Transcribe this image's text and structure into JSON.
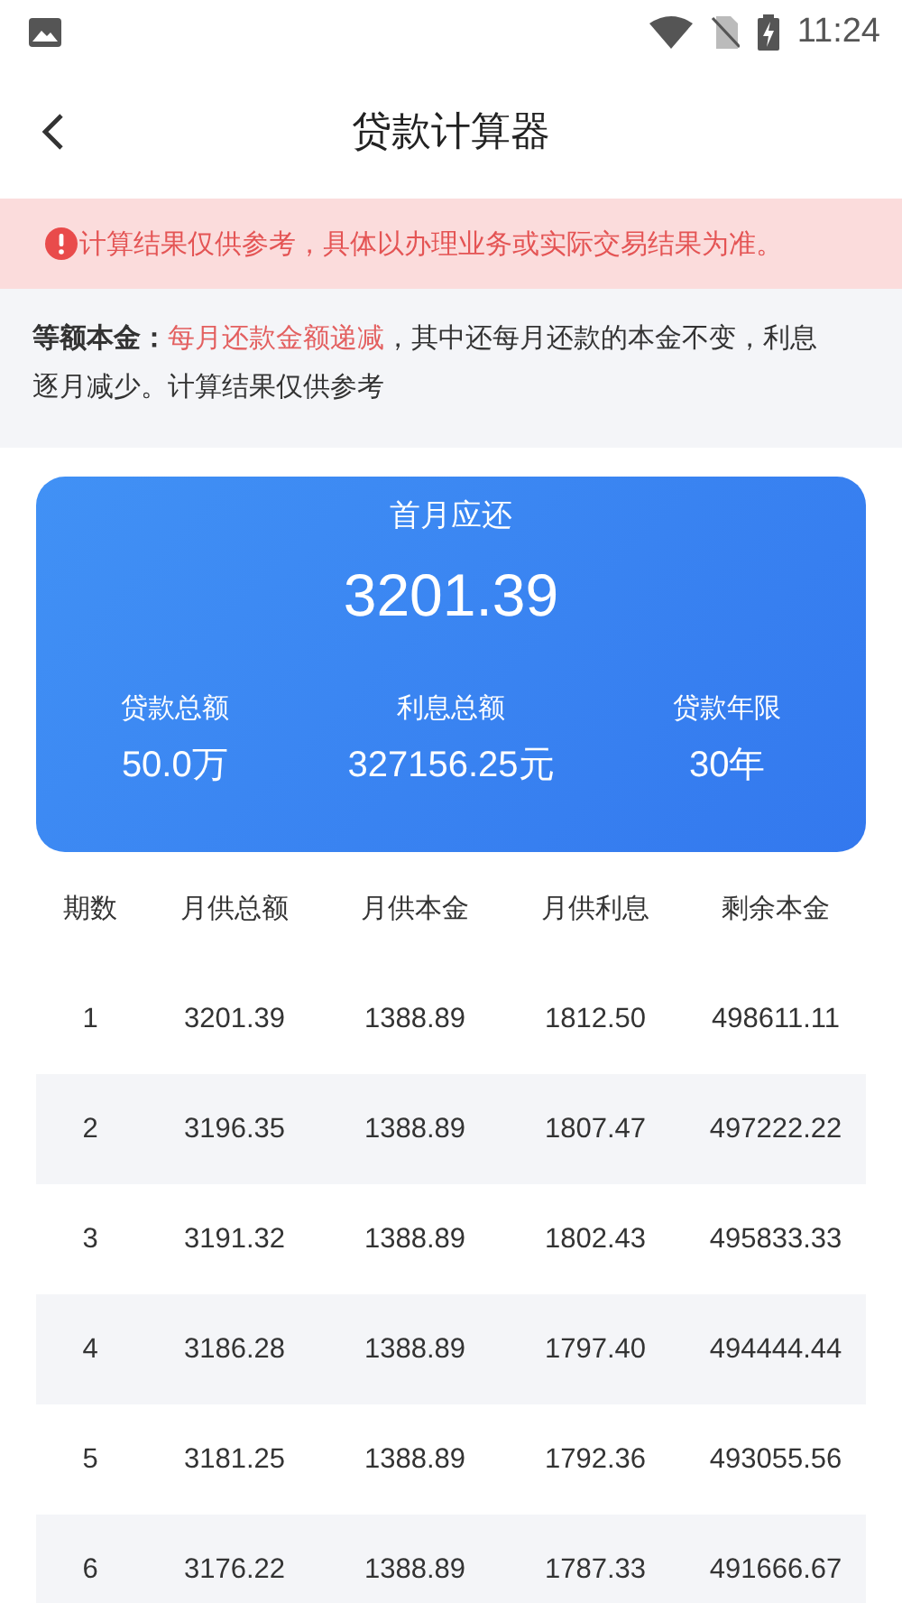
{
  "status_bar": {
    "time": "11:24"
  },
  "header": {
    "title": "贷款计算器"
  },
  "notice": {
    "text": "计算结果仅供参考，具体以办理业务或实际交易结果为准。"
  },
  "info": {
    "label": "等额本金：",
    "highlight": "每月还款金额递减",
    "rest": "，其中还每月还款的本金不变，利息逐月减少。计算结果仅供参考"
  },
  "summary": {
    "title": "首月应还",
    "amount": "3201.39",
    "stats": [
      {
        "label": "贷款总额",
        "value": "50.0万"
      },
      {
        "label": "利息总额",
        "value": "327156.25元"
      },
      {
        "label": "贷款年限",
        "value": "30年"
      }
    ]
  },
  "table": {
    "columns": [
      "期数",
      "月供总额",
      "月供本金",
      "月供利息",
      "剩余本金"
    ],
    "rows": [
      [
        "1",
        "3201.39",
        "1388.89",
        "1812.50",
        "498611.11"
      ],
      [
        "2",
        "3196.35",
        "1388.89",
        "1807.47",
        "497222.22"
      ],
      [
        "3",
        "3191.32",
        "1388.89",
        "1802.43",
        "495833.33"
      ],
      [
        "4",
        "3186.28",
        "1388.89",
        "1797.40",
        "494444.44"
      ],
      [
        "5",
        "3181.25",
        "1388.89",
        "1792.36",
        "493055.56"
      ],
      [
        "6",
        "3176.22",
        "1388.89",
        "1787.33",
        "491666.67"
      ]
    ]
  }
}
